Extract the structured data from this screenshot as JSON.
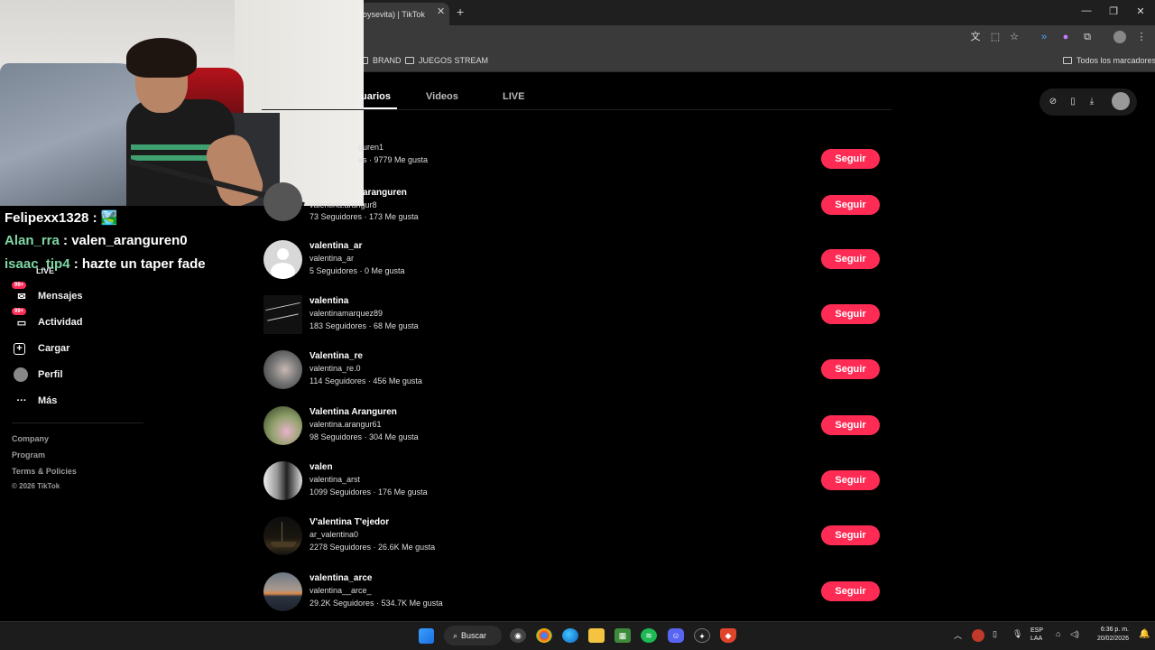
{
  "browser": {
    "tab_title": "oysevita) | TikTok",
    "bookmarks": [
      "BRAND",
      "JUEGOS STREAM"
    ],
    "bookmarks_right": "Todos los marcadores"
  },
  "chat": [
    {
      "user": "Felipexx1328",
      "message": ": 🏞️"
    },
    {
      "user": "Alan_rra",
      "message": ": valen_aranguren0"
    },
    {
      "user": "isaac_tip4",
      "message": ": hazte un taper fade"
    }
  ],
  "sidebar": {
    "items": [
      {
        "label": "LIVE",
        "icon": "live-icon"
      },
      {
        "label": "Mensajes",
        "icon": "messages-icon",
        "badge": "99+"
      },
      {
        "label": "Actividad",
        "icon": "activity-icon",
        "badge": "99+"
      },
      {
        "label": "Cargar",
        "icon": "upload-icon"
      },
      {
        "label": "Perfil",
        "icon": "profile-icon"
      },
      {
        "label": "Más",
        "icon": "more-icon"
      }
    ],
    "footer": [
      "Company",
      "Program",
      "Terms & Policies",
      "© 2026 TikTok"
    ]
  },
  "tabs": [
    "uarios",
    "Videos",
    "LIVE"
  ],
  "results": [
    {
      "name": "",
      "username": "guren1",
      "stats": "es  ·  9779 Me gusta",
      "follow": "Seguir"
    },
    {
      "name": "aranguren",
      "username": "valentina.arangur8",
      "stats": "73 Seguidores  ·  173 Me gusta",
      "follow": "Seguir"
    },
    {
      "name": "valentina_ar",
      "username": "valentina_ar",
      "stats": "5 Seguidores  ·  0 Me gusta",
      "follow": "Seguir"
    },
    {
      "name": "valentina",
      "username": "valentinamarquez89",
      "stats": "183 Seguidores  ·  68 Me gusta",
      "follow": "Seguir"
    },
    {
      "name": "Valentina_re",
      "username": "valentina_re.0",
      "stats": "114 Seguidores  ·  456 Me gusta",
      "follow": "Seguir"
    },
    {
      "name": "Valentina Aranguren",
      "username": "valentina.arangur61",
      "stats": "98 Seguidores  ·  304 Me gusta",
      "follow": "Seguir"
    },
    {
      "name": "valen",
      "username": "valentina_arst",
      "stats": "1099 Seguidores  ·  176 Me gusta",
      "follow": "Seguir"
    },
    {
      "name": "V'alentina T'ejedor",
      "username": "ar_valentina0",
      "stats": "2278 Seguidores  ·  26.6K Me gusta",
      "follow": "Seguir"
    },
    {
      "name": "valentina_arce",
      "username": "valentina__arce_",
      "stats": "29.2K Seguidores  ·  534.7K Me gusta",
      "follow": "Seguir"
    }
  ],
  "taskbar": {
    "search": "Buscar",
    "lang": "ESP",
    "lang2": "LAA",
    "time": "6:36 p. m.",
    "date": "20/02/2026"
  },
  "colors": {
    "accent": "#fe2c55",
    "background": "#000000"
  }
}
